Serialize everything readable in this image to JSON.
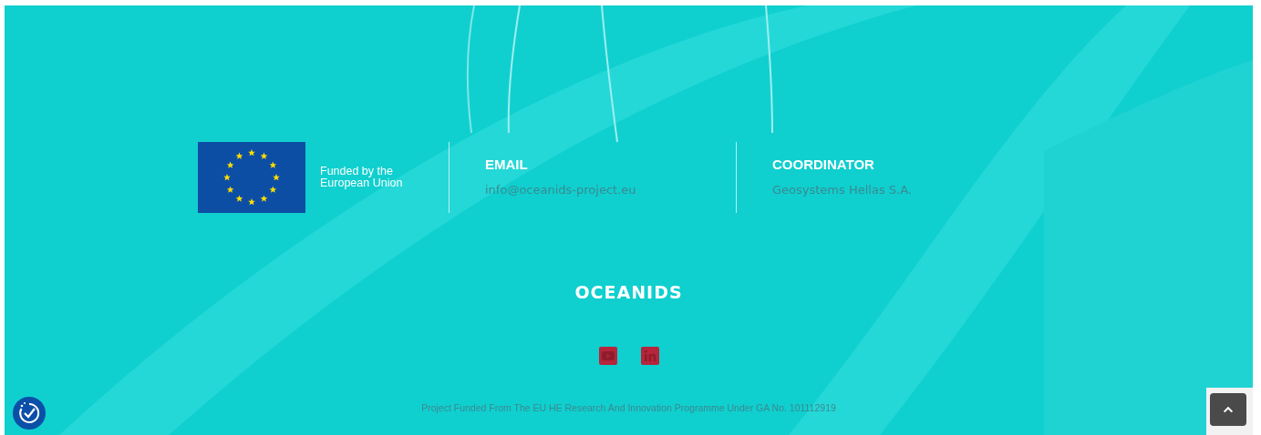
{
  "eu_badge": {
    "caption_lines": [
      "Funded by the",
      "European Union"
    ]
  },
  "contacts": [
    {
      "heading": "EMAIL",
      "value": "info@oceanids-project.eu"
    },
    {
      "heading": "COORDINATOR",
      "value": "Geosystems Hellas S.A."
    }
  ],
  "logo": {
    "text": "OCEANIDS"
  },
  "social": [
    {
      "kind": "youtube"
    },
    {
      "kind": "linkedin"
    }
  ],
  "footer_note": "Project Funded From The EU HE Research And Innovation Programme Under GA No. 101112919"
}
